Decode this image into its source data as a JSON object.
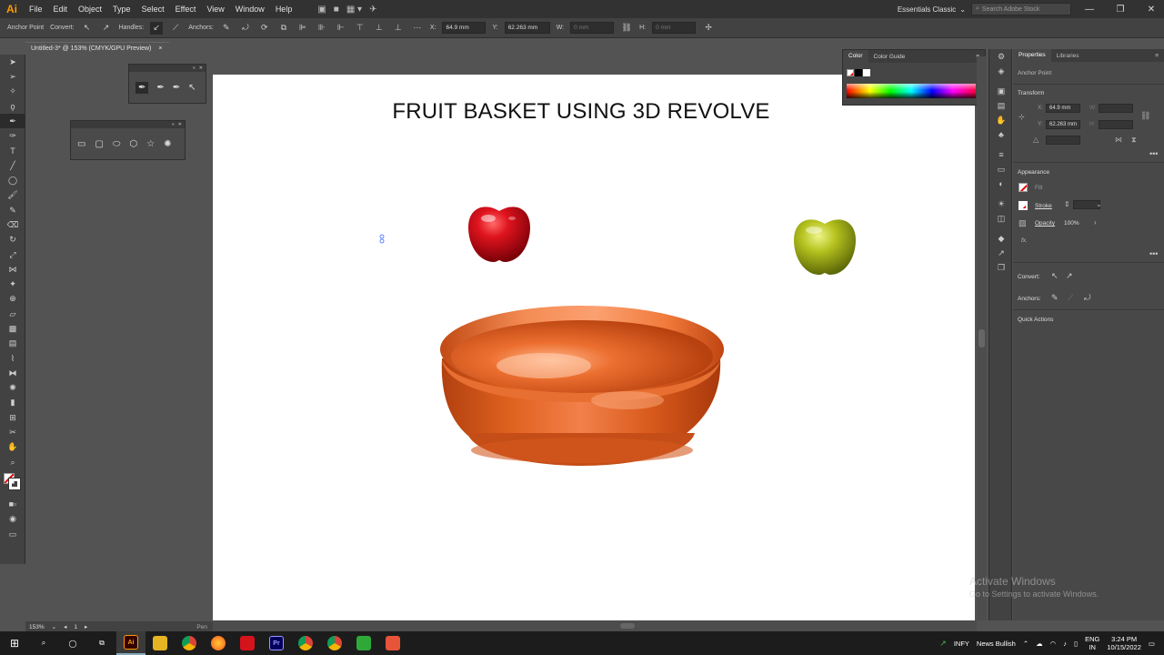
{
  "app": {
    "logo": "Ai",
    "menus": [
      "File",
      "Edit",
      "Object",
      "Type",
      "Select",
      "Effect",
      "View",
      "Window",
      "Help"
    ],
    "workspace": "Essentials Classic",
    "stock_search_placeholder": "Search Adobe Stock"
  },
  "control_bar": {
    "tool_name": "Anchor Point",
    "convert_label": "Convert:",
    "handles_label": "Handles:",
    "anchors_label": "Anchors:",
    "x_label": "X:",
    "x_value": "64.9 mm",
    "y_label": "Y:",
    "y_value": "62.263 mm",
    "w_label": "W:",
    "w_value": "0 mm",
    "h_label": "H:",
    "h_value": "0 mm"
  },
  "document": {
    "tab_title": "Untitled-3* @ 153% (CMYK/GPU Preview)",
    "tab_close": "×"
  },
  "artboard": {
    "title": "FRUIT BASKET USING 3D REVOLVE"
  },
  "color_panel": {
    "tabs": [
      "Color",
      "Color Guide"
    ]
  },
  "properties": {
    "tabs": [
      "Properties",
      "Libraries"
    ],
    "selection": "Anchor Point",
    "transform_heading": "Transform",
    "x_label": "X:",
    "x_value": "64.9 mm",
    "y_label": "Y:",
    "y_value": "62.263 mm",
    "w_label": "W:",
    "h_label": "H:",
    "appearance_heading": "Appearance",
    "fill_label": "Fill",
    "stroke_label": "Stroke",
    "opacity_label": "Opacity",
    "opacity_value": "100%",
    "fx_label": "fx.",
    "convert_label": "Convert:",
    "anchors_label": "Anchors:",
    "quick_actions_heading": "Quick Actions"
  },
  "status_bar": {
    "zoom": "153%",
    "artboard_number": "1",
    "tool": "Pen"
  },
  "watermark": {
    "line1": "Activate Windows",
    "line2": "Go to Settings to activate Windows."
  },
  "taskbar": {
    "weather_text": "INFY",
    "news_text": "News Bullish",
    "language": "ENG",
    "region": "IN",
    "time": "3:24 PM",
    "date": "10/15/2022"
  },
  "colors": {
    "app_bg": "#535353",
    "panel_bg": "#424242",
    "basket": "#d9541e",
    "apple_red": "#c8101a",
    "apple_green": "#a5b420",
    "illustrator_orange": "#ff9a00"
  }
}
